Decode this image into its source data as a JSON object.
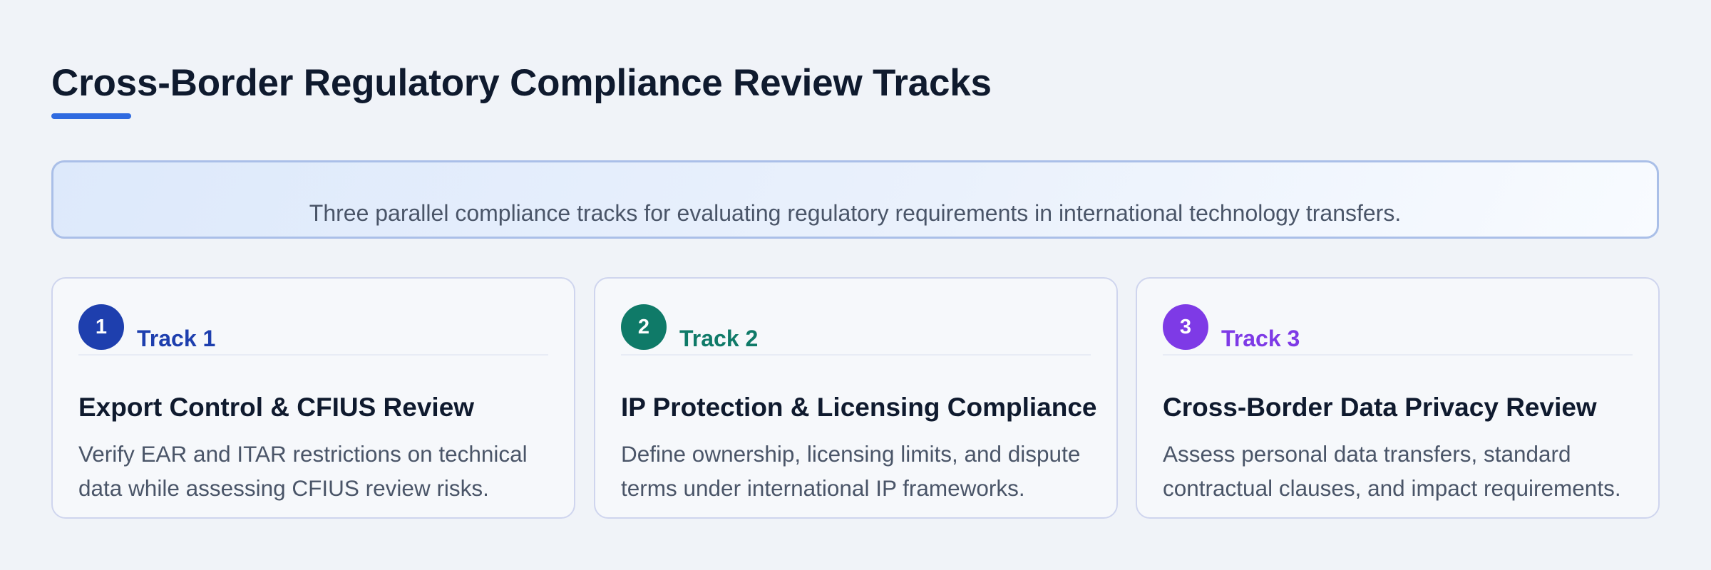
{
  "page": {
    "title": "Cross-Border Regulatory Compliance Review Tracks",
    "intro": "Three parallel compliance tracks for evaluating regulatory requirements in international technology transfers."
  },
  "colors": {
    "background": "#f0f3f8",
    "title_underline": "#2f6ae0",
    "track1": "#1e3fae",
    "track2": "#0f7a68",
    "track3": "#7e3ae6"
  },
  "tracks": [
    {
      "number": "1",
      "label": "Track 1",
      "title": "Export Control & CFIUS Review",
      "description": "Verify EAR and ITAR restrictions on technical data while assessing CFIUS review risks.",
      "color": "#1e3fae"
    },
    {
      "number": "2",
      "label": "Track 2",
      "title": "IP Protection & Licensing Compliance",
      "description": "Define ownership, licensing limits, and dispute terms under international IP frameworks.",
      "color": "#0f7a68"
    },
    {
      "number": "3",
      "label": "Track 3",
      "title": "Cross-Border Data Privacy Review",
      "description": "Assess personal data transfers, standard contractual clauses, and impact requirements.",
      "color": "#7e3ae6"
    }
  ]
}
